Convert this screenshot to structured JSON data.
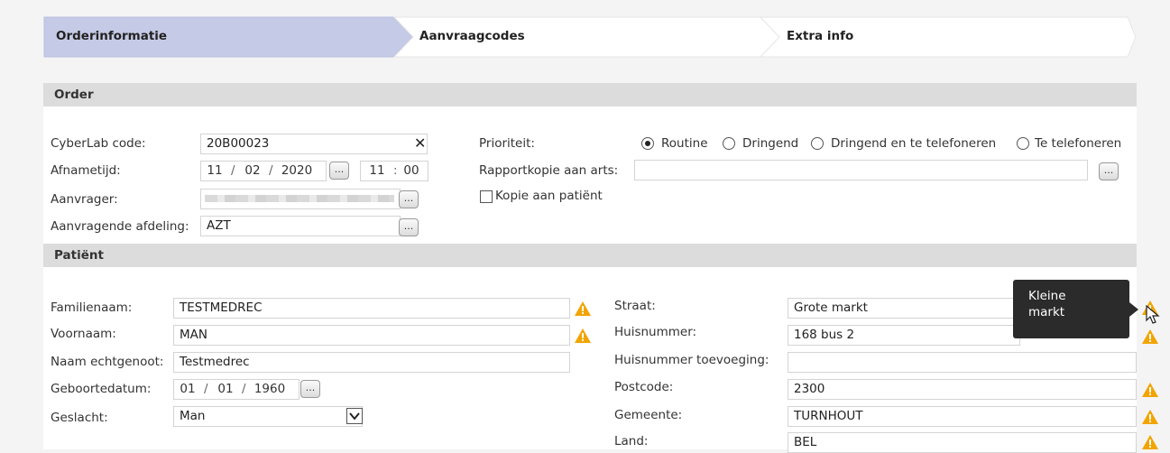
{
  "steps": [
    {
      "label": "Orderinformatie",
      "active": true
    },
    {
      "label": "Aanvraagcodes",
      "active": false
    },
    {
      "label": "Extra info",
      "active": false
    }
  ],
  "order": {
    "section_title": "Order",
    "cyberlab_label": "CyberLab code:",
    "cyberlab_value": "20B00023",
    "afnametijd_label": "Afnametijd:",
    "afname_day": "11",
    "afname_month": "02",
    "afname_year": "2020",
    "afname_hour": "11",
    "afname_minute": "00",
    "aanvrager_label": "Aanvrager:",
    "aanvrager_value": "",
    "afdeling_label": "Aanvragende afdeling:",
    "afdeling_value": "AZT",
    "prioriteit_label": "Prioriteit:",
    "priority_options": [
      {
        "label": "Routine",
        "checked": true
      },
      {
        "label": "Dringend",
        "checked": false
      },
      {
        "label": "Dringend en te telefoneren",
        "checked": false
      },
      {
        "label": "Te telefoneren",
        "checked": false
      }
    ],
    "rapportkopie_label": "Rapportkopie aan arts:",
    "rapportkopie_value": "",
    "kopie_patient_label": "Kopie aan patiënt",
    "kopie_patient_checked": false,
    "dots_label": "..."
  },
  "patient": {
    "section_title": "Patiënt",
    "familienaam_label": "Familienaam:",
    "familienaam_value": "TESTMEDREC",
    "voornaam_label": "Voornaam:",
    "voornaam_value": "MAN",
    "echtgenoot_label": "Naam echtgenoot:",
    "echtgenoot_value": "Testmedrec",
    "geboortedatum_label": "Geboortedatum:",
    "geb_day": "01",
    "geb_month": "01",
    "geb_year": "1960",
    "geslacht_label": "Geslacht:",
    "geslacht_value": "Man",
    "straat_label": "Straat:",
    "straat_value": "Grote markt",
    "huisnummer_label": "Huisnummer:",
    "huisnummer_value": "168 bus 2",
    "toevoeging_label": "Huisnummer toevoeging:",
    "toevoeging_value": "",
    "postcode_label": "Postcode:",
    "postcode_value": "2300",
    "gemeente_label": "Gemeente:",
    "gemeente_value": "TURNHOUT",
    "land_label": "Land:",
    "land_value": "BEL"
  },
  "tooltip": {
    "line1": "Kleine",
    "line2": "markt"
  },
  "colors": {
    "active_step": "#c5cae6",
    "warning": "#f2a400",
    "section": "#dcdcdc"
  }
}
